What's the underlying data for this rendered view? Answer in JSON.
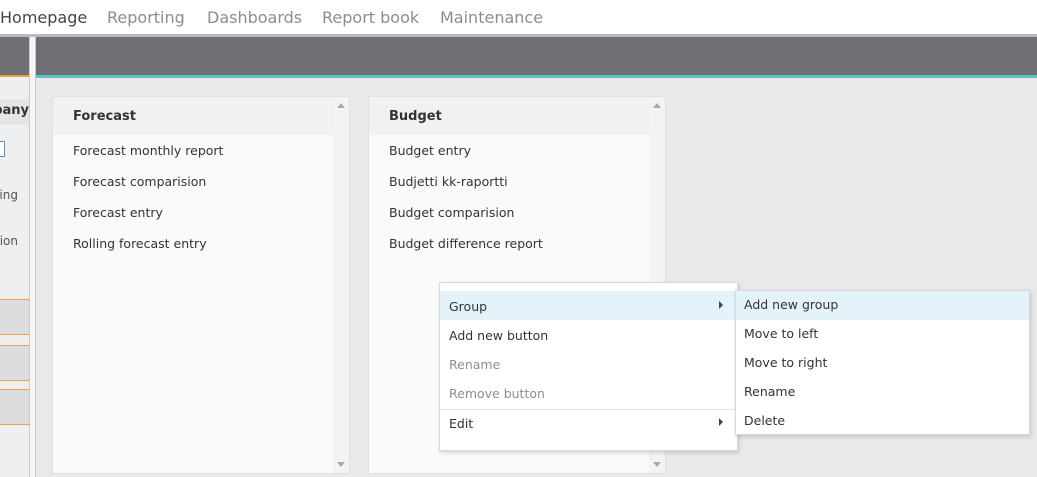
{
  "topnav": {
    "tabs": [
      {
        "label": "Homepage",
        "active": true
      },
      {
        "label": "Reporting",
        "active": false
      },
      {
        "label": "Dashboards",
        "active": false
      },
      {
        "label": "Report book",
        "active": false
      },
      {
        "label": "Maintenance",
        "active": false
      }
    ]
  },
  "sidebar": {
    "header": "Company",
    "item1": "Reporting",
    "item2": "Consolidation"
  },
  "panels": [
    {
      "title": "Forecast",
      "items": [
        "Forecast monthly report",
        "Forecast comparision",
        "Forecast entry",
        "Rolling forecast entry"
      ]
    },
    {
      "title": "Budget",
      "items": [
        "Budget entry",
        "Budjetti kk-raportti",
        "Budget comparision",
        "Budget difference report"
      ]
    }
  ],
  "context_menu": {
    "items": [
      {
        "label": "Group",
        "submenu": true,
        "enabled": true
      },
      {
        "label": "Add new button",
        "submenu": false,
        "enabled": true
      },
      {
        "label": "Rename",
        "submenu": false,
        "enabled": false
      },
      {
        "label": "Remove button",
        "submenu": false,
        "enabled": false
      },
      {
        "label": "Edit",
        "submenu": true,
        "enabled": true
      }
    ]
  },
  "group_submenu": {
    "items": [
      "Add new group",
      "Move to left",
      "Move to right",
      "Rename",
      "Delete"
    ]
  },
  "colors": {
    "accent_teal": "#5bc2c8",
    "accent_orange": "#f0a040",
    "dark_bar": "#6e7073",
    "menu_hover": "#e4f3fa"
  }
}
